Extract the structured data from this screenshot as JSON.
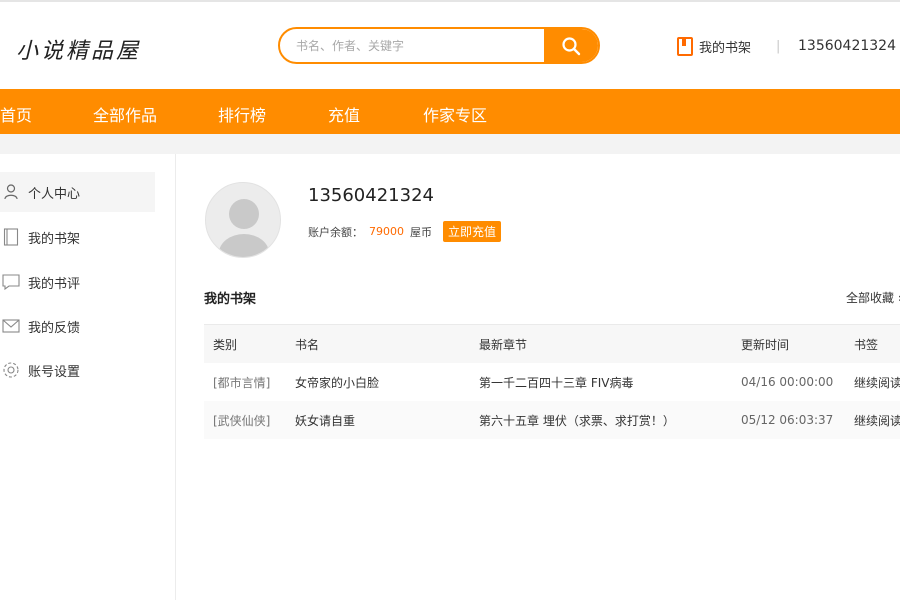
{
  "header": {
    "logo": "小说精品屋",
    "search_placeholder": "书名、作者、关键字",
    "shelf_label": "我的书架",
    "divider": "|",
    "phone": "13560421324"
  },
  "nav": [
    "首页",
    "全部作品",
    "排行榜",
    "充值",
    "作家专区"
  ],
  "sidebar": {
    "items": [
      {
        "label": "个人中心",
        "icon": "user-icon",
        "active": true
      },
      {
        "label": "我的书架",
        "icon": "book-icon"
      },
      {
        "label": "我的书评",
        "icon": "comment-icon"
      },
      {
        "label": "我的反馈",
        "icon": "mail-icon"
      },
      {
        "label": "账号设置",
        "icon": "gear-icon"
      }
    ]
  },
  "profile": {
    "username": "13560421324",
    "balance_label": "账户余额：",
    "balance_amount": "79000",
    "balance_unit": "屋币",
    "recharge_button": "立即充值"
  },
  "shelf": {
    "title": "我的书架",
    "all_link": "全部收藏 »",
    "columns": [
      "类别",
      "书名",
      "最新章节",
      "更新时间",
      "书签"
    ],
    "rows": [
      {
        "category": "[都市言情]",
        "book": "女帝家的小白脸",
        "latest": "第一千二百四十三章 FIV病毒",
        "updated": "04/16 00:00:00",
        "bookmark": "继续阅读"
      },
      {
        "category": "[武侠仙侠]",
        "book": "妖女请自重",
        "latest": "第六十五章 埋伏（求票、求打赏！）",
        "updated": "05/12 06:03:37",
        "bookmark": "继续阅读"
      }
    ]
  },
  "colors": {
    "accent": "#ff8c00",
    "price": "#ff6a00"
  }
}
